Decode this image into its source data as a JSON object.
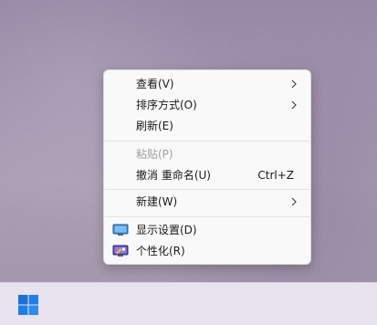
{
  "desktop": {
    "wallpaper_desc_color": "#9a8aa8"
  },
  "context_menu": {
    "items": [
      {
        "label": "查看(V)",
        "submenu": true
      },
      {
        "label": "排序方式(O)",
        "submenu": true
      },
      {
        "label": "刷新(E)"
      },
      {
        "label": "粘贴(P)",
        "disabled": true
      },
      {
        "label": "撤消 重命名(U)",
        "shortcut": "Ctrl+Z"
      },
      {
        "label": "新建(W)",
        "submenu": true
      },
      {
        "label": "显示设置(D)",
        "icon": "display-settings-icon"
      },
      {
        "label": "个性化(R)",
        "icon": "personalize-icon"
      }
    ]
  },
  "taskbar": {
    "start_icon": "windows-logo-icon",
    "accent_color": "#1a6fd8"
  }
}
